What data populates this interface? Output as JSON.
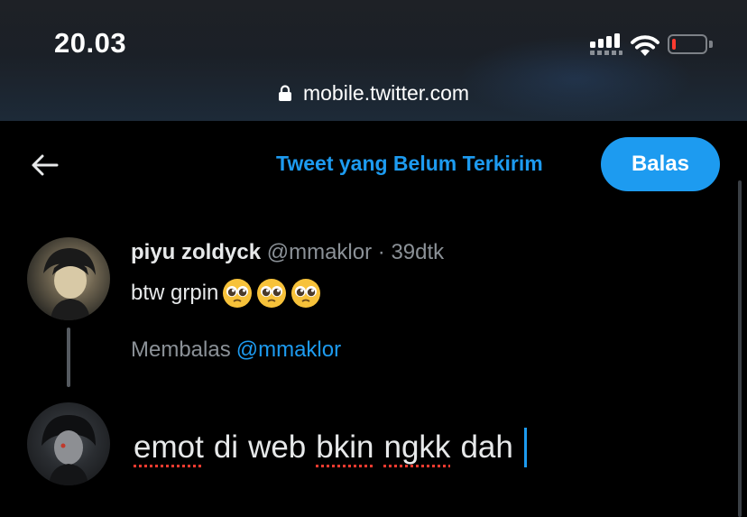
{
  "status_bar": {
    "time": "20.03",
    "battery_level": 0.1,
    "battery_color": "#ff3b30"
  },
  "browser": {
    "url": "mobile.twitter.com"
  },
  "header": {
    "back_icon": "arrow-left-icon",
    "unsent_tweets_label": "Tweet yang Belum Terkirim",
    "reply_button_label": "Balas"
  },
  "original_tweet": {
    "display_name": "piyu zoldyck",
    "handle": "@mmaklor",
    "separator": "·",
    "time_ago": "39dtk",
    "text": "btw grpin",
    "emojis": [
      "pleading-face-emoji",
      "pleading-face-emoji",
      "pleading-face-emoji"
    ]
  },
  "reply_context": {
    "prefix": "Membalas",
    "handle": "@mmaklor"
  },
  "compose": {
    "words": [
      "emot",
      "di",
      "web",
      "bkin",
      "ngkk",
      "dah"
    ],
    "misspelled": [
      true,
      false,
      false,
      true,
      true,
      false
    ]
  },
  "colors": {
    "accent": "#1d9bf0",
    "background": "#000000",
    "secondary_text": "#8b9197"
  }
}
